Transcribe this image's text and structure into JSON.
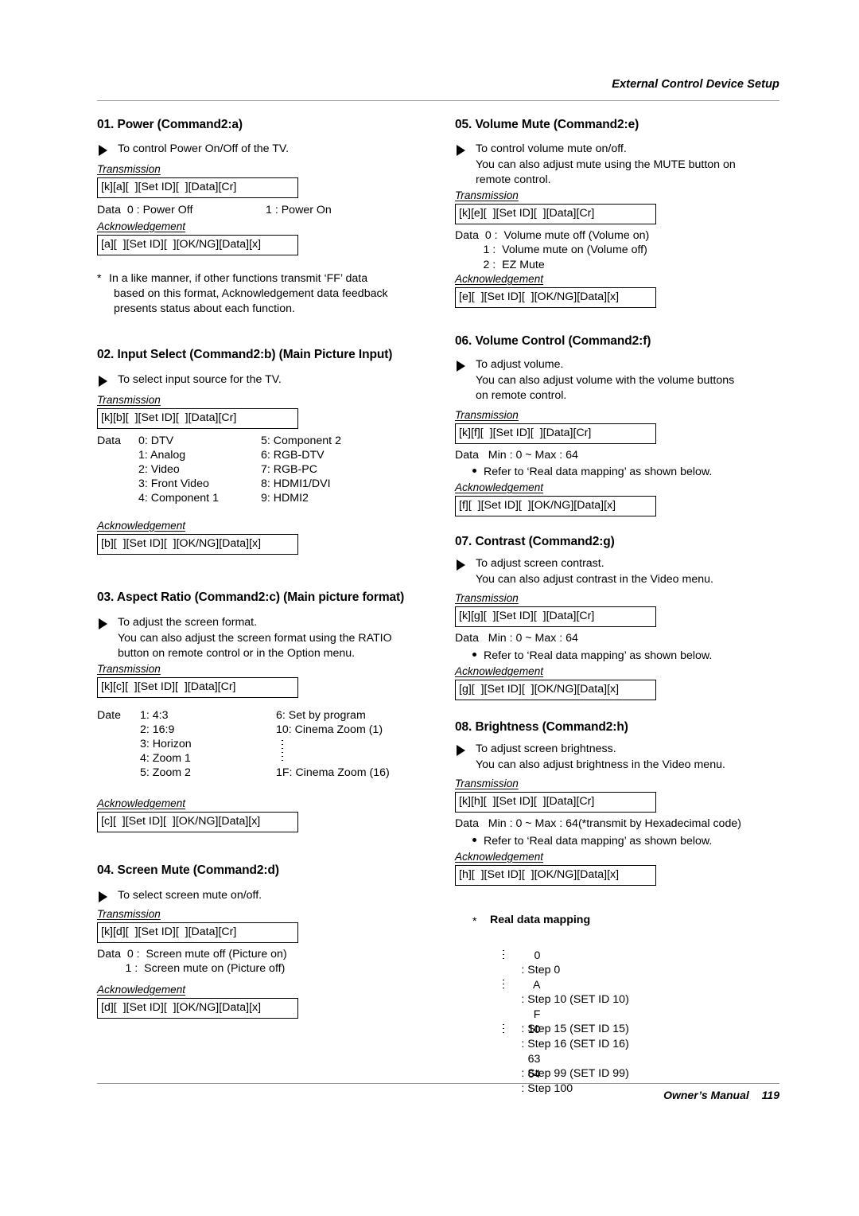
{
  "running_head": "External Control Device Setup",
  "footer": {
    "manual": "Owner’s Manual",
    "page": "119"
  },
  "labels": {
    "transmission": "Transmission",
    "acknowledgement": "Acknowledgement"
  },
  "sections": {
    "s01": {
      "title": "01. Power (Command2:a)",
      "desc": "To control Power On/Off of the TV.",
      "tx": "[k][a][  ][Set ID][  ][Data][Cr]",
      "data_left": "Data  0 : Power Off",
      "data_right": "1 : Power On",
      "ack": "[a][  ][Set ID][  ][OK/NG][Data][x]",
      "note_star": "*",
      "note_l1": "In a like manner, if other functions transmit ‘FF’ data",
      "note_l2": "based on this format, Acknowledgement data feedback",
      "note_l3": "presents status about each function."
    },
    "s02": {
      "title": "02. Input Select (Command2:b) (Main Picture Input)",
      "desc": "To select input source for the TV.",
      "tx": "[k][b][  ][Set ID][  ][Data][Cr]",
      "data_word": "Data",
      "col_a": [
        "0: DTV",
        "1: Analog",
        "2: Video",
        "3: Front Video",
        "4: Component 1"
      ],
      "col_b": [
        "5: Component 2",
        "6: RGB-DTV",
        "7: RGB-PC",
        "8: HDMI1/DVI",
        "9: HDMI2"
      ],
      "ack": "[b][  ][Set ID][  ][OK/NG][Data][x]"
    },
    "s03": {
      "title": "03. Aspect Ratio (Command2:c) (Main picture format)",
      "desc_l1": "To adjust the screen format.",
      "desc_l2": "You can also adjust the screen format using the RATIO",
      "desc_l3": "button on remote control or in the Option menu.",
      "tx": "[k][c][  ][Set ID][  ][Data][Cr]",
      "data_word": "Date",
      "col_a": [
        "1: 4:3",
        "2: 16:9",
        "3: Horizon",
        "4: Zoom 1",
        "5: Zoom 2"
      ],
      "col_b_top": [
        "6: Set by program",
        "10: Cinema Zoom (1)"
      ],
      "col_b_bottom": "1F: Cinema Zoom (16)",
      "ack": "[c][  ][Set ID][  ][OK/NG][Data][x]"
    },
    "s04": {
      "title": "04. Screen Mute (Command2:d)",
      "desc": "To select screen mute on/off.",
      "tx": "[k][d][  ][Set ID][  ][Data][Cr]",
      "data_l1": "Data  0 :  Screen mute off (Picture on)",
      "data_l2": "         1 :  Screen mute on (Picture off)",
      "ack": "[d][  ][Set ID][  ][OK/NG][Data][x]"
    },
    "s05": {
      "title": "05. Volume Mute (Command2:e)",
      "desc_l1": "To control volume mute on/off.",
      "desc_l2": "You can also adjust mute using the MUTE button on",
      "desc_l3": "remote control.",
      "tx": "[k][e][  ][Set ID][  ][Data][Cr]",
      "data_l1": "Data  0 :  Volume mute off (Volume on)",
      "data_l2": "         1 :  Volume mute on (Volume off)",
      "data_l3": "         2 :  EZ Mute",
      "ack": "[e][  ][Set ID][  ][OK/NG][Data][x]"
    },
    "s06": {
      "title": "06. Volume Control (Command2:f)",
      "desc_l1": "To adjust volume.",
      "desc_l2": "You can also adjust volume with the volume buttons",
      "desc_l3": "on remote control.",
      "tx": "[k][f][  ][Set ID][  ][Data][Cr]",
      "data": "Data   Min : 0 ~ Max : 64",
      "refer": "Refer to ‘Real data mapping’ as shown below.",
      "ack": "[f][  ][Set ID][  ][OK/NG][Data][x]"
    },
    "s07": {
      "title": "07. Contrast (Command2:g)",
      "desc_l1": "To adjust screen contrast.",
      "desc_l2": "You can also adjust contrast in the Video menu.",
      "tx": "[k][g][  ][Set ID][  ][Data][Cr]",
      "data": "Data   Min : 0 ~ Max : 64",
      "refer": "Refer to ‘Real data mapping’ as shown below.",
      "ack": "[g][  ][Set ID][  ][OK/NG][Data][x]"
    },
    "s08": {
      "title": "08. Brightness (Command2:h)",
      "desc_l1": "To adjust screen brightness.",
      "desc_l2": "You can also adjust brightness in the Video menu.",
      "tx": "[k][h][  ][Set ID][  ][Data][Cr]",
      "data": "Data   Min : 0 ~ Max : 64(*transmit by Hexadecimal code)",
      "refer": "Refer to ‘Real data mapping’ as shown below.",
      "ack": "[h][  ][Set ID][  ][OK/NG][Data][x]"
    },
    "rdm": {
      "star": "*",
      "title": "Real data mapping",
      "rows": [
        {
          "code": "0",
          "text": ": Step 0"
        },
        {
          "code": "A",
          "text": ": Step 10 (SET ID 10)"
        },
        {
          "code": "F",
          "text": ": Step 15 (SET ID 15)"
        },
        {
          "code": "10",
          "text": ": Step 16 (SET ID 16)"
        },
        {
          "code": "63",
          "text": ": Step 99 (SET ID 99)"
        },
        {
          "code": "64",
          "text": ": Step 100"
        }
      ]
    }
  }
}
